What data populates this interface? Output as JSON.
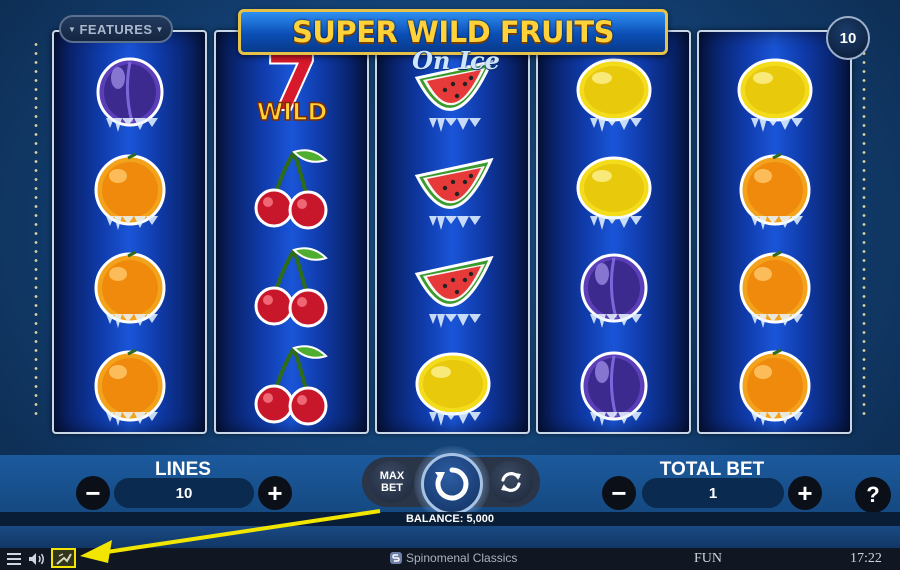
{
  "header": {
    "logo_title": "SUPER WILD FRUITS",
    "logo_subtitle": "On Ice",
    "features_label": "FEATURES",
    "lines_badge": "10"
  },
  "reels": [
    [
      "plum",
      "orange",
      "orange",
      "orange"
    ],
    [
      "wild-seven",
      "cherry",
      "cherry",
      "cherry"
    ],
    [
      "watermelon",
      "watermelon",
      "watermelon",
      "lemon"
    ],
    [
      "lemon",
      "lemon",
      "plum",
      "plum"
    ],
    [
      "lemon",
      "orange",
      "orange",
      "orange"
    ]
  ],
  "symbols": {
    "wild_text": "WILD",
    "seven_text": "7"
  },
  "controls": {
    "lines_label": "LINES",
    "lines_value": "10",
    "minus": "−",
    "plus": "+",
    "max_bet_label": "MAX BET",
    "total_bet_label": "TOTAL BET",
    "total_bet_value": "1",
    "help": "?"
  },
  "balance": "BALANCE: 5,000",
  "status_bar": {
    "brand": "Spinomenal Classics",
    "mode": "FUN",
    "time": "17:22"
  },
  "colors": {
    "reel_blue": "#1a55d8",
    "gold": "#ffd23a",
    "annotation_yellow": "#f2e600"
  }
}
